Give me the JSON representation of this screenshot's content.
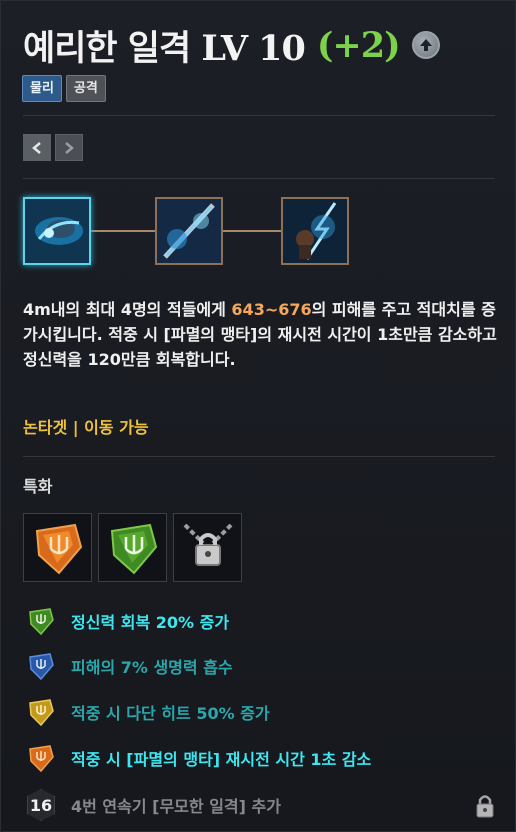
{
  "skill": {
    "name": "예리한 일격 LV 10",
    "bonus": "(+2)"
  },
  "tags": [
    {
      "label": "물리"
    },
    {
      "label": "공격"
    }
  ],
  "tripods": [
    {
      "name": "tripod-1"
    },
    {
      "name": "tripod-2"
    },
    {
      "name": "tripod-3"
    }
  ],
  "description": {
    "before": "4m내의 최대 4명의 적들에게 ",
    "damage": "643~676",
    "after": "의 피해를 주고 적대치를 증가시킵니다. 적중 시 [파멸의 맹타]의 재시전 시간이 1초만큼 감소하고 정신력을 120만큼 회복합니다."
  },
  "targeting": "논타겟 | 이동 가능",
  "specialization": {
    "title": "특화",
    "bonuses": [
      {
        "text": "정신력 회복 20% 증가",
        "color": "#3ee6f0",
        "gem": "green"
      },
      {
        "text": "피해의 7% 생명력 흡수",
        "color": "#2aa7ab",
        "gem": "blue"
      },
      {
        "text": "적중 시 다단 히트 50% 증가",
        "color": "#2aa7ab",
        "gem": "yellow"
      },
      {
        "text": "적중 시 [파멸의 맹타] 재시전 시간 1초 감소",
        "color": "#3ee6f0",
        "gem": "orange"
      },
      {
        "level": "16",
        "text": "4번 연속기 [무모한 일격] 추가",
        "color": "#85888d"
      }
    ]
  },
  "colors": {
    "accent_green": "#7cd24a",
    "damage_orange": "#f5a85a",
    "target_yellow": "#f0c23c"
  }
}
